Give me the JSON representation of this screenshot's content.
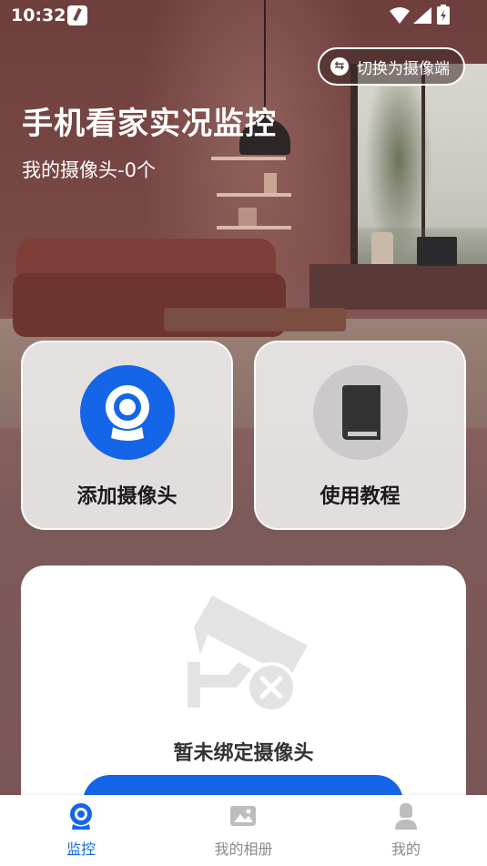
{
  "status_bar": {
    "time": "10:32"
  },
  "header": {
    "switch_label": "切换为摄像端",
    "title": "手机看家实况监控",
    "camera_count": "我的摄像头-0个"
  },
  "actions": {
    "add_camera_label": "添加摄像头",
    "tutorial_label": "使用教程"
  },
  "empty_state": {
    "message": "暂未绑定摄像头"
  },
  "bottom_nav": {
    "items": [
      {
        "label": "监控",
        "icon": "camera-icon",
        "active": true
      },
      {
        "label": "我的相册",
        "icon": "album-icon",
        "active": false
      },
      {
        "label": "我的",
        "icon": "profile-icon",
        "active": false
      }
    ]
  },
  "colors": {
    "accent": "#1565e8",
    "inactive": "#8a8a8a"
  }
}
